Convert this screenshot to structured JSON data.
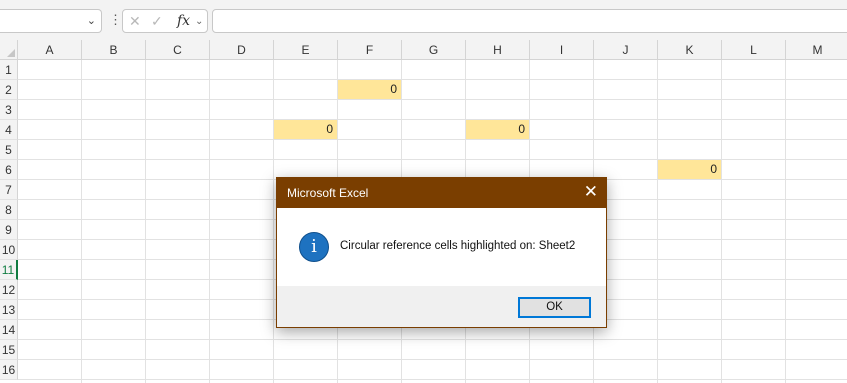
{
  "formula_bar": {
    "namebox_value": "",
    "dots_icon": "more-vertical-icon",
    "cancel_icon": "x-icon",
    "enter_icon": "check-icon",
    "fx_label": "fx",
    "formula_value": ""
  },
  "columns": [
    "A",
    "B",
    "C",
    "D",
    "E",
    "F",
    "G",
    "H",
    "I",
    "J",
    "K",
    "L",
    "M"
  ],
  "rows": [
    "1",
    "2",
    "3",
    "4",
    "5",
    "6",
    "7",
    "8",
    "9",
    "10",
    "11",
    "12",
    "13",
    "14",
    "15",
    "16"
  ],
  "active_row": "11",
  "cells": {
    "F2": "0",
    "E4": "0",
    "H4": "0",
    "K6": "0"
  },
  "highlight_color": "#ffe699",
  "dialog": {
    "title": "Microsoft Excel",
    "icon": "info-icon",
    "icon_glyph": "i",
    "message": "Circular reference cells highlighted on: Sheet2",
    "ok_label": "OK",
    "title_bar_color": "#7a3e00"
  }
}
